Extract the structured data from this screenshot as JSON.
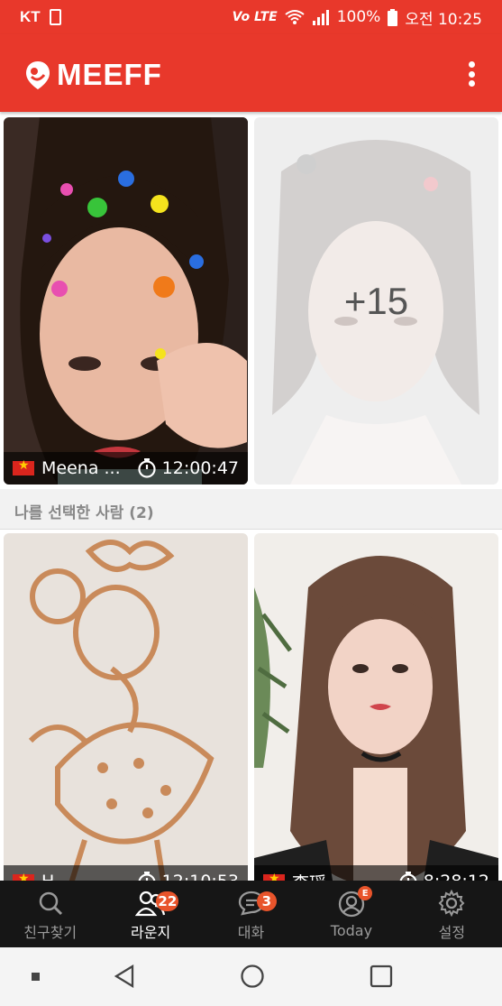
{
  "status_bar": {
    "carrier": "KT",
    "network": "Vo LTE",
    "battery": "100%",
    "time": "오전 10:25"
  },
  "app": {
    "brand": "MEEFF",
    "menu_icon": "more-vert-icon"
  },
  "cards_top": [
    {
      "name": "Meena ...",
      "timer": "12:00:47",
      "flag": "vietnam-flag"
    },
    {
      "overlay_count": "+15"
    }
  ],
  "section": {
    "title": "나를 선택한 사람 (2)"
  },
  "cards_bottom": [
    {
      "name": "H",
      "timer": "12:10:53",
      "flag": "vietnam-flag"
    },
    {
      "name": "李瑶",
      "timer": "8:28:12",
      "flag": "vietnam-flag"
    }
  ],
  "nav": {
    "items": [
      {
        "label": "친구찾기",
        "icon": "search-icon",
        "badge": ""
      },
      {
        "label": "라운지",
        "icon": "people-icon",
        "badge": "22"
      },
      {
        "label": "대화",
        "icon": "chat-icon",
        "badge": "3"
      },
      {
        "label": "Today",
        "icon": "profile-icon",
        "badge": "E"
      },
      {
        "label": "설정",
        "icon": "gear-icon",
        "badge": ""
      }
    ]
  },
  "colors": {
    "brand_red": "#e8382b",
    "nav_bg": "#161616",
    "badge_orange": "#e8542b"
  }
}
